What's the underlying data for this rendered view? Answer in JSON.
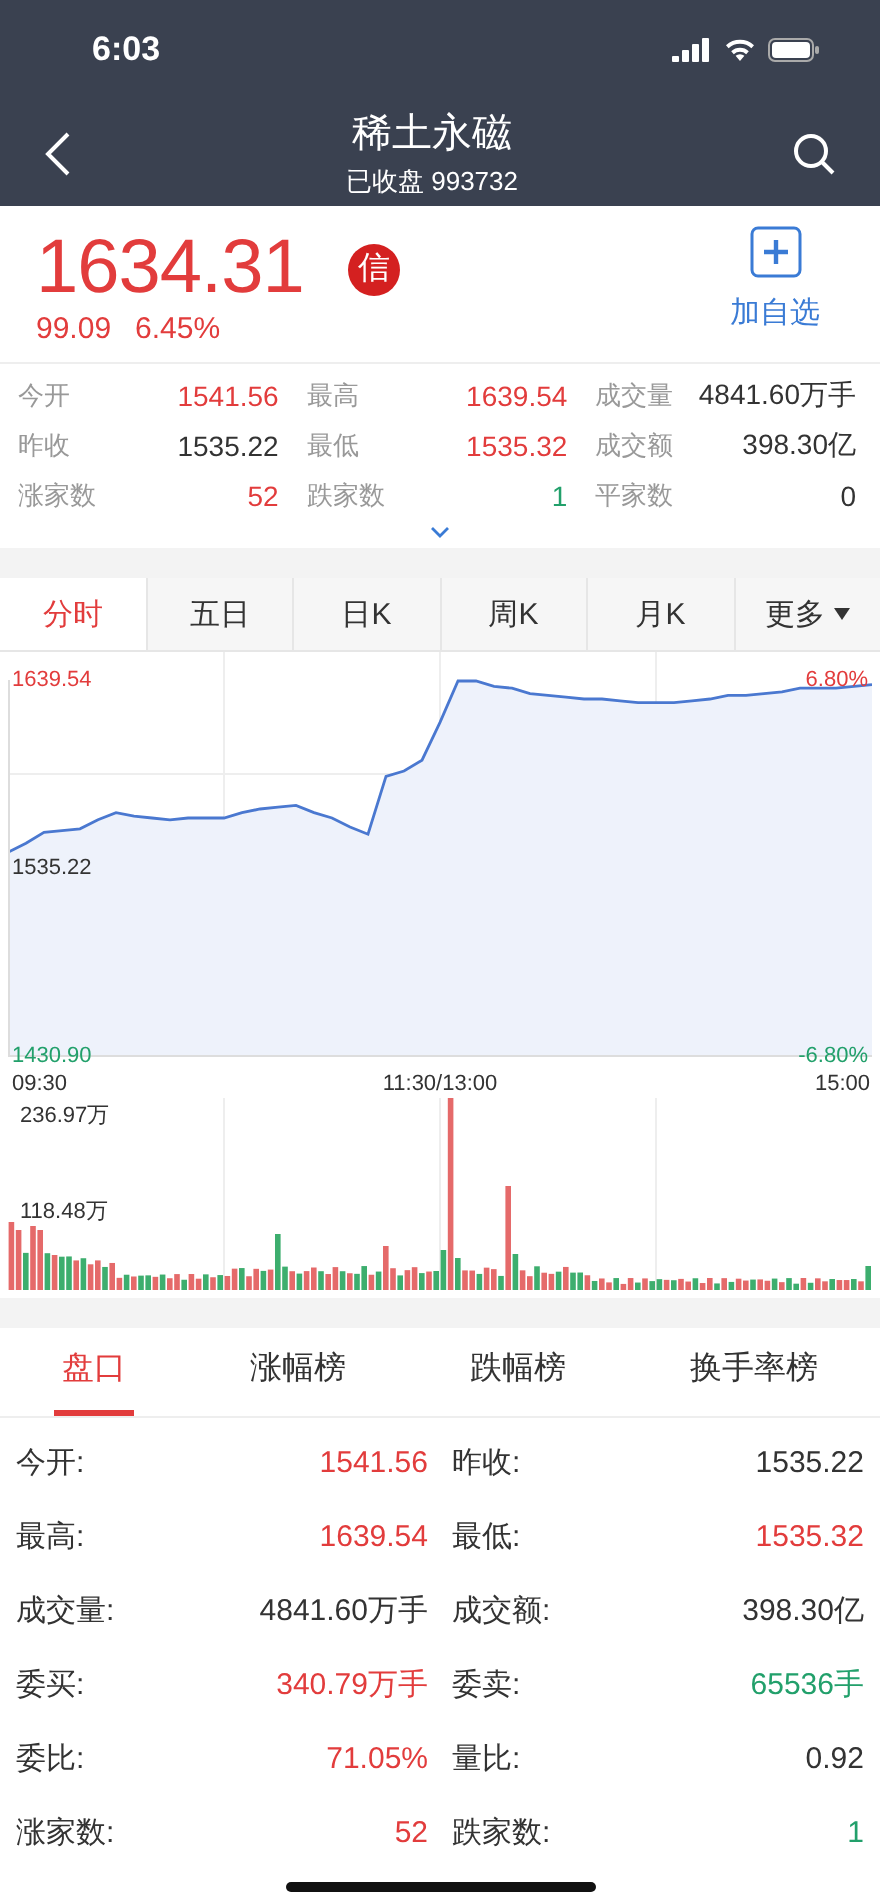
{
  "status_bar": {
    "time": "6:03"
  },
  "header": {
    "title": "稀土永磁",
    "subtitle": "已收盘 993732"
  },
  "quote": {
    "price": "1634.31",
    "change": "99.09",
    "change_pct": "6.45%",
    "badge": "信",
    "watch_label": "加自选"
  },
  "stats": [
    {
      "label": "今开",
      "value": "1541.56",
      "color": "#e23c3c"
    },
    {
      "label": "最高",
      "value": "1639.54",
      "color": "#e23c3c"
    },
    {
      "label": "成交量",
      "value": "4841.60万手",
      "color": "#333333"
    },
    {
      "label": "昨收",
      "value": "1535.22",
      "color": "#333333"
    },
    {
      "label": "最低",
      "value": "1535.32",
      "color": "#e23c3c"
    },
    {
      "label": "成交额",
      "value": "398.30亿",
      "color": "#333333"
    },
    {
      "label": "涨家数",
      "value": "52",
      "color": "#e23c3c"
    },
    {
      "label": "跌家数",
      "value": "1",
      "color": "#22a06b"
    },
    {
      "label": "平家数",
      "value": "0",
      "color": "#333333"
    }
  ],
  "chart_tabs": [
    {
      "label": "分时",
      "selected": true,
      "has_menu": false
    },
    {
      "label": "五日",
      "selected": false,
      "has_menu": false
    },
    {
      "label": "日K",
      "selected": false,
      "has_menu": false
    },
    {
      "label": "周K",
      "selected": false,
      "has_menu": false
    },
    {
      "label": "月K",
      "selected": false,
      "has_menu": false
    },
    {
      "label": "更多",
      "selected": false,
      "has_menu": true
    }
  ],
  "price_chart": {
    "right_labels": [
      "6.80%",
      "-6.80%"
    ],
    "time_labels": [
      "09:30",
      "11:30/13:00",
      "15:00"
    ],
    "chart_data": {
      "type": "area",
      "grid": true,
      "ylim": [
        1430.9,
        1639.54
      ],
      "yticks": [
        {
          "value": 1639.54,
          "label": "1639.54"
        },
        {
          "value": 1535.22,
          "label": "1535.22"
        },
        {
          "value": 1430.9,
          "label": "1430.90"
        }
      ],
      "series": [
        {
          "color": "#4a78d0",
          "values": [
            1544,
            1549,
            1555,
            1556,
            1557,
            1562,
            1566,
            1564,
            1563,
            1562,
            1563,
            1563,
            1563,
            1566,
            1568,
            1569,
            1570,
            1566,
            1563,
            1558,
            1554,
            1586,
            1589,
            1595,
            1616,
            1639,
            1639,
            1636,
            1635,
            1632,
            1631,
            1630,
            1629,
            1629,
            1628,
            1627,
            1627,
            1627,
            1628,
            1629,
            1631,
            1631,
            1632,
            1633,
            1635,
            1635,
            1635,
            1636,
            1637
          ]
        }
      ]
    }
  },
  "volume_chart": {
    "top_label": "236.97万",
    "mid_label": "118.48万"
  },
  "detail_tabs": [
    {
      "label": "盘口",
      "selected": true
    },
    {
      "label": "涨幅榜",
      "selected": false
    },
    {
      "label": "跌幅榜",
      "selected": false
    },
    {
      "label": "换手率榜",
      "selected": false
    }
  ],
  "details": [
    {
      "label": "今开:",
      "value": "1541.56",
      "color": "#e23c3c"
    },
    {
      "label": "昨收:",
      "value": "1535.22",
      "color": "#333333"
    },
    {
      "label": "最高:",
      "value": "1639.54",
      "color": "#e23c3c"
    },
    {
      "label": "最低:",
      "value": "1535.32",
      "color": "#e23c3c"
    },
    {
      "label": "成交量:",
      "value": "4841.60万手",
      "color": "#333333"
    },
    {
      "label": "成交额:",
      "value": "398.30亿",
      "color": "#333333"
    },
    {
      "label": "委买:",
      "value": "340.79万手",
      "color": "#e23c3c"
    },
    {
      "label": "委卖:",
      "value": "65536手",
      "color": "#22a06b"
    },
    {
      "label": "委比:",
      "value": "71.05%",
      "color": "#e23c3c"
    },
    {
      "label": "量比:",
      "value": "0.92",
      "color": "#333333"
    },
    {
      "label": "涨家数:",
      "value": "52",
      "color": "#e23c3c"
    },
    {
      "label": "跌家数:",
      "value": "1",
      "color": "#22a06b"
    }
  ]
}
